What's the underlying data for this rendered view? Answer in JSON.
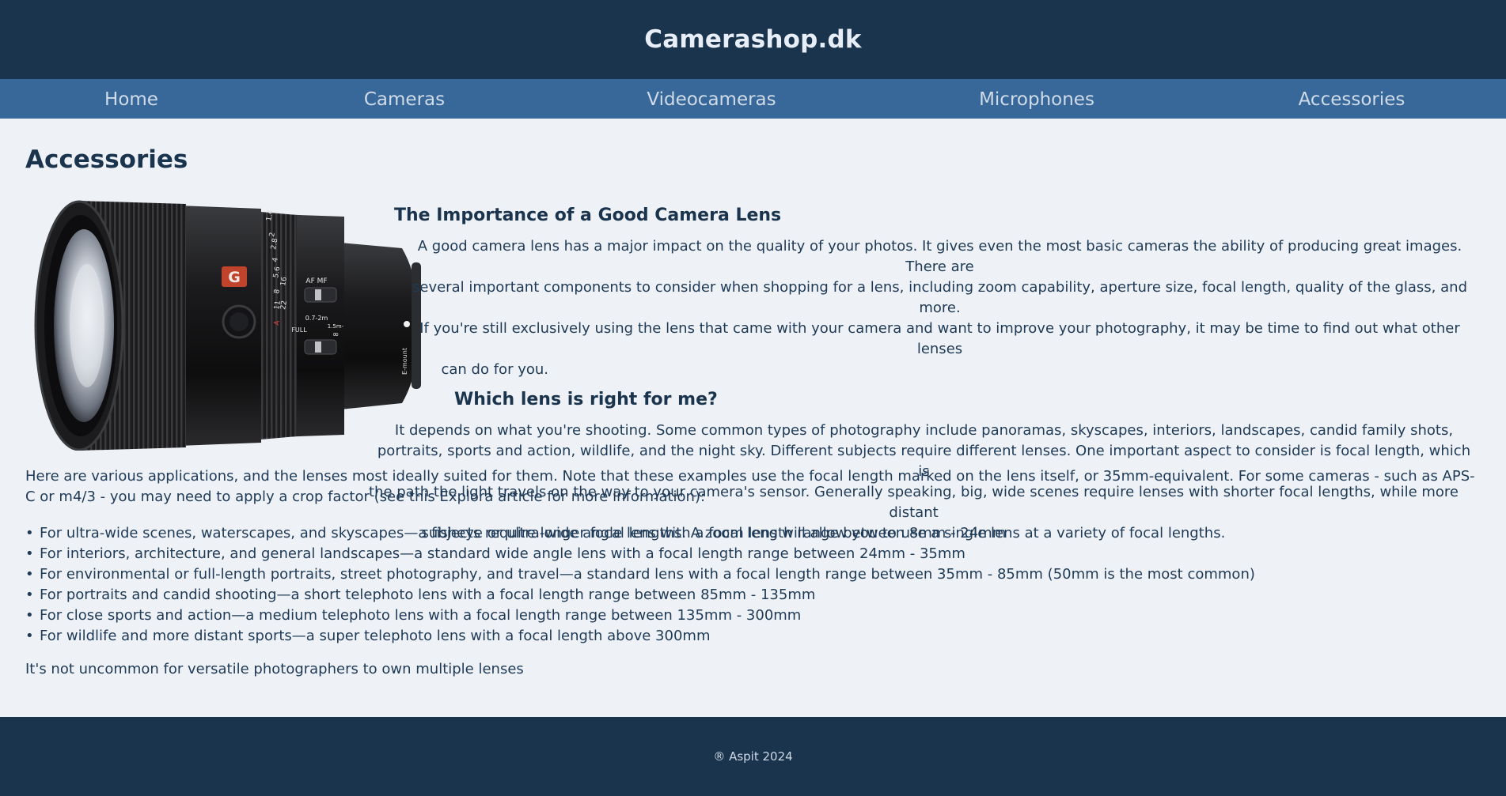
{
  "site": {
    "title": "Camerashop.dk"
  },
  "nav": {
    "items": [
      {
        "label": "Home"
      },
      {
        "label": "Cameras"
      },
      {
        "label": "Videocameras"
      },
      {
        "label": "Microphones"
      },
      {
        "label": "Accessories"
      }
    ]
  },
  "page": {
    "title": "Accessories"
  },
  "product_image": {
    "lens_badge": "G",
    "af_mf": "AF  MF",
    "range": "0.7-2m",
    "full": "FULL",
    "range2": "1.5m-",
    "inf": "∞",
    "mount": "E-mount",
    "scale": [
      "16",
      "11",
      "8",
      "5.6",
      "4",
      "2.8",
      "2",
      "1.4"
    ],
    "scale2": [
      "22"
    ],
    "a_mark": "A"
  },
  "article": {
    "heading1": "The Importance of a Good Camera Lens",
    "p1_lines": [
      "A good camera lens has a major impact on the quality of your photos. It gives even the most basic cameras the ability of producing great images. There are",
      "several important components to consider when shopping for a lens, including zoom capability, aperture size, focal length, quality of the glass, and more.",
      "If you're still exclusively using the lens that came with your camera and want to improve your photography, it may be time to find out what other lenses",
      "can do for you."
    ],
    "heading2": "Which lens is right for me?",
    "p2_lines": [
      "It depends on what you're shooting. Some common types of photography include panoramas, skyscapes, interiors, landscapes, candid family shots,",
      "portraits, sports and action, wildlife, and the night sky. Different subjects require different lenses. One important aspect to consider is focal length, which is",
      "the path the light travels on the way to your camera's sensor. Generally speaking, big, wide scenes require lenses with shorter focal lengths, while more distant",
      "subjects require longer focal lengths. A zoom lens will allow you to use a single lens at a variety of focal lengths."
    ]
  },
  "applications": {
    "intro": "Here are various applications, and the lenses most ideally suited for them. Note that these examples use the focal length marked on the lens itself, or 35mm-equivalent. For some cameras - such as APS-C or m4/3 - you may need to apply a crop factor (see this Explora article for more information):",
    "items": [
      "For ultra-wide scenes, waterscapes, and skyscapes—a fisheye or ultra-wide angle lens with a focal length range between 8mm - 24mm",
      "For interiors, architecture, and general landscapes—a standard wide angle lens with a focal length range between 24mm - 35mm",
      "For environmental or full-length portraits, street photography, and travel—a standard lens with a focal length range between 35mm - 85mm (50mm is the most common)",
      "For portraits and candid shooting—a short telephoto lens with a focal length range between 85mm - 135mm",
      "For close sports and action—a medium telephoto lens with a focal length range between 135mm - 300mm",
      "For wildlife and more distant sports—a super telephoto lens with a focal length above 300mm"
    ],
    "closing": "It's not uncommon for versatile photographers to own multiple lenses"
  },
  "footer": {
    "copyright": "® Aspit 2024"
  }
}
